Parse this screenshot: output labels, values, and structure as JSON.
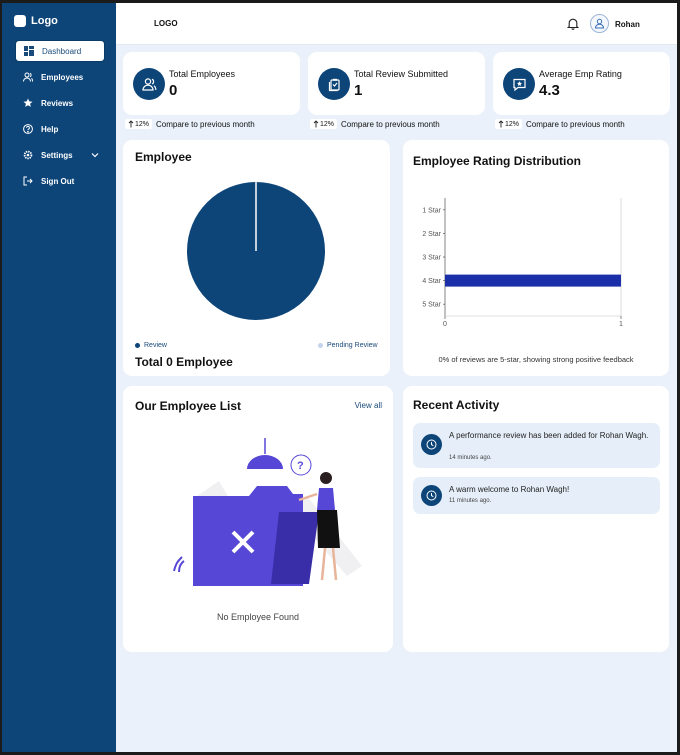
{
  "sidebar": {
    "brand": "Logo",
    "items": [
      {
        "label": "Dashboard",
        "icon": "dashboard-icon"
      },
      {
        "label": "Employees",
        "icon": "users-icon"
      },
      {
        "label": "Reviews",
        "icon": "star-icon"
      },
      {
        "label": "Help",
        "icon": "help-icon"
      },
      {
        "label": "Settings",
        "icon": "gear-icon"
      },
      {
        "label": "Sign Out",
        "icon": "sign-out-icon"
      }
    ]
  },
  "header": {
    "logo": "LOGO",
    "user_name": "Rohan"
  },
  "stats": [
    {
      "label": "Total Employees",
      "value": "0",
      "trend": "12%",
      "compare": "Compare to previous month"
    },
    {
      "label": "Total Review Submitted",
      "value": "1",
      "trend": "12%",
      "compare": "Compare to previous month"
    },
    {
      "label": "Average Emp Rating",
      "value": "4.3",
      "trend": "12%",
      "compare": "Compare to previous month"
    }
  ],
  "employee_card": {
    "title": "Employee",
    "legend_review": "Review",
    "legend_pending": "Pending Review",
    "total": "Total 0 Employee"
  },
  "rating_card": {
    "title": "Employee Rating Distribution",
    "caption": "0% of reviews are 5-star, showing strong positive feedback"
  },
  "employee_list": {
    "title": "Our Employee List",
    "view_all": "View all",
    "empty": "No Employee Found"
  },
  "activity": {
    "title": "Recent Activity",
    "items": [
      {
        "text": "A performance review has been added for Rohan Wagh.",
        "time": "14 minutes ago."
      },
      {
        "text": "A warm welcome to Rohan Wagh!",
        "time": "11 minutes ago."
      }
    ]
  },
  "colors": {
    "primary": "#0d4579",
    "background": "#eaf1fb",
    "bar": "#1a2fa8",
    "pending": "#c5d3ec",
    "illustration": "#5747d6"
  },
  "chart_data": [
    {
      "type": "pie",
      "title": "Employee",
      "categories": [
        "Review",
        "Pending Review"
      ],
      "values": [
        1,
        0
      ]
    },
    {
      "type": "bar",
      "orientation": "horizontal",
      "title": "Employee Rating Distribution",
      "categories": [
        "1 Star",
        "2 Star",
        "3 Star",
        "4 Star",
        "5 Star"
      ],
      "values": [
        0,
        0,
        0,
        1,
        0
      ],
      "xlim": [
        0,
        1
      ],
      "x_ticks": [
        "0",
        "1"
      ]
    }
  ]
}
